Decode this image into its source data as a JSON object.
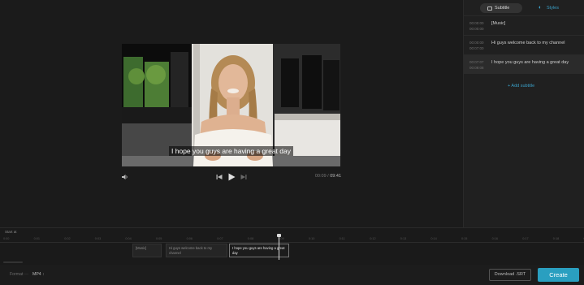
{
  "nav": {
    "back_icon": "chevron-left-icon",
    "back_glyph": "‹"
  },
  "video": {
    "caption": "I hope you guys are having a great day",
    "current_time": "00:09",
    "separator": "/",
    "total_time": "09:41"
  },
  "player": {
    "volume_icon": "volume-icon",
    "prev_icon": "skip-back-icon",
    "play_icon": "play-icon",
    "next_icon": "skip-forward-icon"
  },
  "panel": {
    "tabs": [
      {
        "label": "Subtitle",
        "icon": "subtitle-icon",
        "active": true
      },
      {
        "label": "Styles",
        "icon": "palette-icon",
        "active": false
      }
    ],
    "subtitles": [
      {
        "start": "00:00:00",
        "end": "00:00:00",
        "text": "[Music]"
      },
      {
        "start": "00:00:00",
        "end": "00:07:00",
        "text": "Hi guys welcome back to my channel"
      },
      {
        "start": "00:07:07",
        "end": "00:09:08",
        "text": "I hope you guys are having a great day",
        "active": true
      }
    ],
    "add_subtitle_label": "+ Add subtitle"
  },
  "timeline": {
    "label": "Start at",
    "ticks": [
      "0:00",
      "0:01",
      "0:02",
      "0:03",
      "0:04",
      "0:05",
      "0:06",
      "0:07",
      "0:08",
      "0:09",
      "0:10",
      "0:11",
      "0:12",
      "0:13",
      "0:14",
      "0:15",
      "0:16",
      "0:17",
      "0:18",
      "0:19"
    ],
    "clips": [
      {
        "text": "[Music]"
      },
      {
        "text": "Hi guys welcome back to my channel"
      },
      {
        "text": "I hope you guys are having a great day",
        "active": true
      }
    ]
  },
  "bottom": {
    "format_label": "Format",
    "format_value": "MP4",
    "download_label": "Download .SRT",
    "create_label": "Create"
  },
  "colors": {
    "accent": "#2a9fc0",
    "background": "#161616",
    "panel": "#202020"
  }
}
